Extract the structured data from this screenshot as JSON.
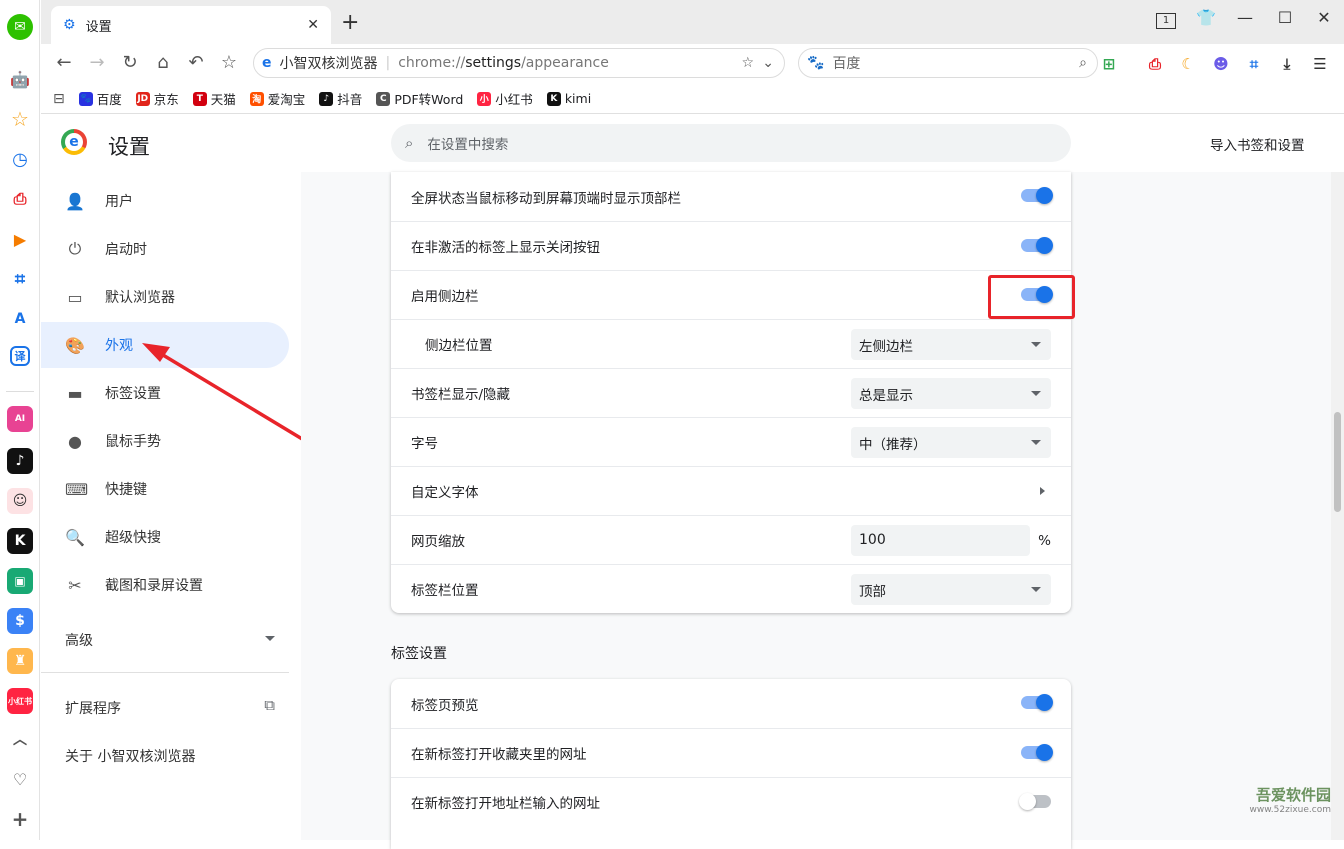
{
  "tab": {
    "title": "设置"
  },
  "window": {
    "tab_count": "1"
  },
  "toolbar": {
    "omnibox_name": "小智双核浏览器",
    "omnibox_url_prefix": "chrome://",
    "omnibox_url_main": "settings",
    "omnibox_url_suffix": "/appearance",
    "search_engine": "百度"
  },
  "bookmarks": [
    {
      "label": "百度",
      "color": "#2932e1",
      "glyph": "🐾"
    },
    {
      "label": "京东",
      "color": "#e1251b",
      "glyph": "JD"
    },
    {
      "label": "天猫",
      "color": "#d2000f",
      "glyph": "T"
    },
    {
      "label": "爱淘宝",
      "color": "#ff5000",
      "glyph": "淘"
    },
    {
      "label": "抖音",
      "color": "#111111",
      "glyph": "♪"
    },
    {
      "label": "PDF转Word",
      "color": "#555555",
      "glyph": "C"
    },
    {
      "label": "小红书",
      "color": "#ff2442",
      "glyph": "小"
    },
    {
      "label": "kimi",
      "color": "#111111",
      "glyph": "K"
    }
  ],
  "settings": {
    "title": "设置",
    "search_placeholder": "在设置中搜索",
    "import_label": "导入书签和设置"
  },
  "nav": [
    {
      "label": "用户",
      "icon": "👤"
    },
    {
      "label": "启动时",
      "icon": "⏻"
    },
    {
      "label": "默认浏览器",
      "icon": "▭"
    },
    {
      "label": "外观",
      "icon": "🎨"
    },
    {
      "label": "标签设置",
      "icon": "▬"
    },
    {
      "label": "鼠标手势",
      "icon": "●"
    },
    {
      "label": "快捷键",
      "icon": "⌨"
    },
    {
      "label": "超级快搜",
      "icon": "🔍"
    },
    {
      "label": "截图和录屏设置",
      "icon": "✂"
    }
  ],
  "nav_advanced": "高级",
  "nav_extensions": "扩展程序",
  "nav_about": "关于 小智双核浏览器",
  "appearance": {
    "fullscreen_topbar": "全屏状态当鼠标移动到屏幕顶端时显示顶部栏",
    "inactive_close": "在非激活的标签上显示关闭按钮",
    "enable_sidebar": "启用侧边栏",
    "sidebar_position": {
      "label": "侧边栏位置",
      "value": "左侧边栏"
    },
    "bookmark_bar": {
      "label": "书签栏显示/隐藏",
      "value": "总是显示"
    },
    "font_size": {
      "label": "字号",
      "value": "中（推荐）"
    },
    "custom_font": "自定义字体",
    "zoom": {
      "label": "网页缩放",
      "value": "100",
      "unit": "%"
    },
    "tabbar_position": {
      "label": "标签栏位置",
      "value": "顶部"
    }
  },
  "tab_section": {
    "title": "标签设置",
    "preview": "标签页预览",
    "new_tab_favorites": "在新标签打开收藏夹里的网址",
    "new_tab_address": "在新标签打开地址栏输入的网址"
  },
  "watermark": {
    "site": "吾爱软件园",
    "url": "www.52zixue.com"
  },
  "colors": {
    "accent": "#1a73e8",
    "highlight": "#e8242a"
  }
}
